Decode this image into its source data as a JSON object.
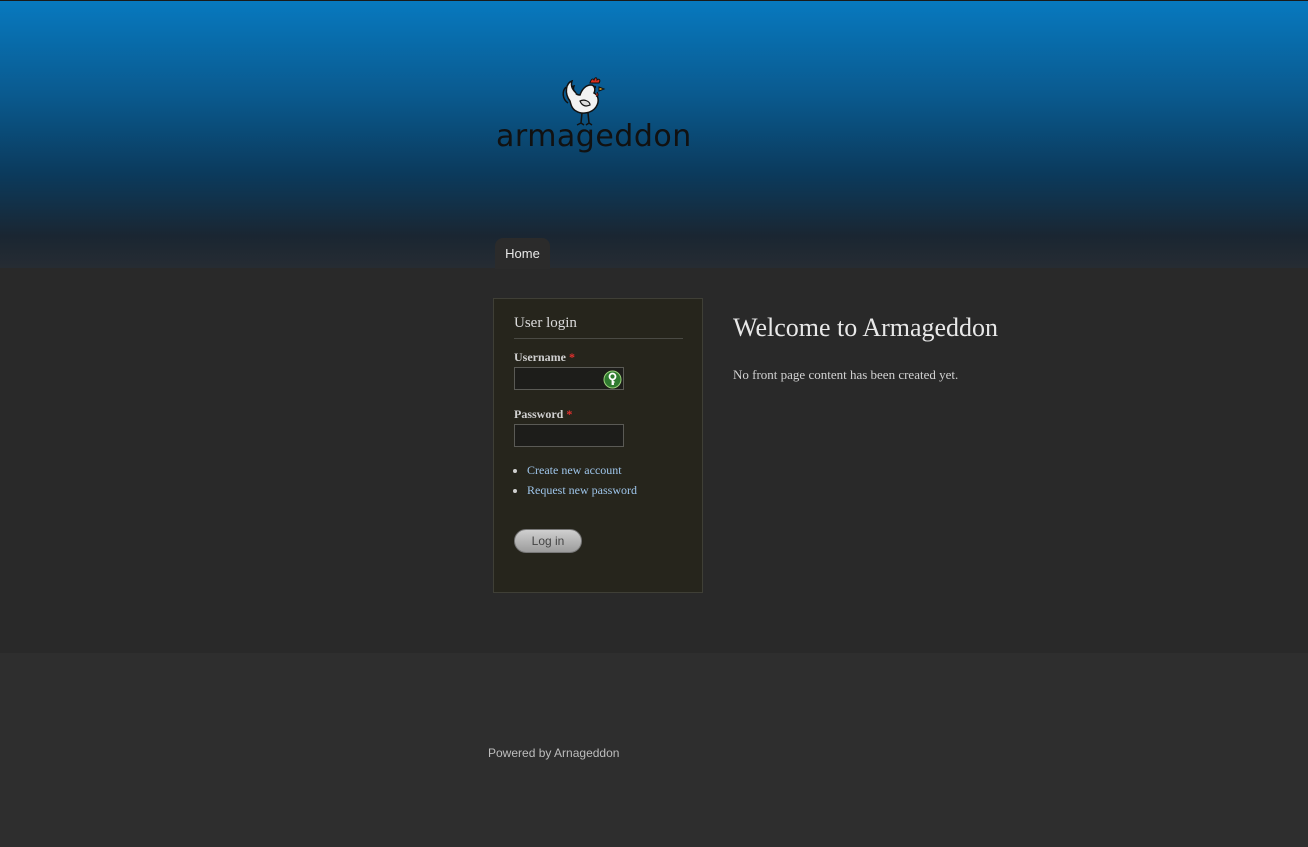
{
  "site": {
    "logo_text": "armageddon",
    "brand_color": "#0779bf"
  },
  "nav": {
    "items": [
      {
        "label": "Home"
      }
    ]
  },
  "login": {
    "title": "User login",
    "username_label": "Username",
    "username_value": "",
    "password_label": "Password",
    "password_value": "",
    "required_mark": "*",
    "links": [
      {
        "label": "Create new account"
      },
      {
        "label": "Request new password"
      }
    ],
    "submit_label": "Log in",
    "key_icon": "password-manager-key-icon"
  },
  "main": {
    "title": "Welcome to Armageddon",
    "body": "No front page content has been created yet."
  },
  "footer": {
    "prefix": "Powered by",
    "link": "Arnageddon"
  }
}
